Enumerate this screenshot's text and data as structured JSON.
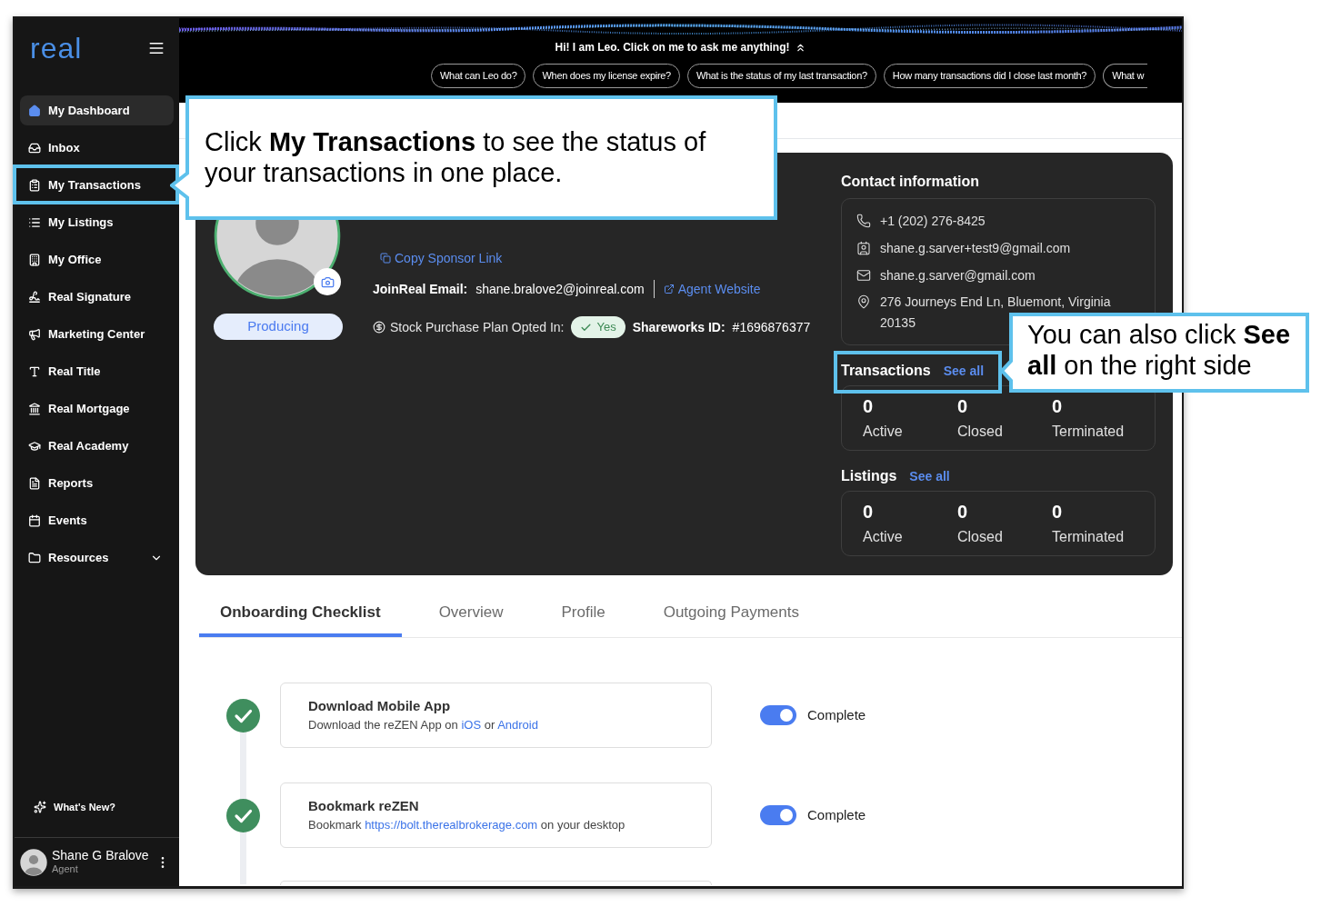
{
  "sidebar": {
    "logo": "real",
    "items": [
      {
        "label": "My Dashboard",
        "selected": true
      },
      {
        "label": "Inbox",
        "selected": false
      },
      {
        "label": "My Transactions",
        "selected": false
      },
      {
        "label": "My Listings",
        "selected": false
      },
      {
        "label": "My Office",
        "selected": false
      },
      {
        "label": "Real Signature",
        "selected": false
      },
      {
        "label": "Marketing Center",
        "selected": false
      },
      {
        "label": "Real Title",
        "selected": false
      },
      {
        "label": "Real Mortgage",
        "selected": false
      },
      {
        "label": "Real Academy",
        "selected": false
      },
      {
        "label": "Reports",
        "selected": false
      },
      {
        "label": "Events",
        "selected": false
      },
      {
        "label": "Resources",
        "selected": false,
        "expanded": false
      }
    ],
    "whats_new": "What's New?",
    "user": {
      "name": "Shane G Bralove",
      "role": "Agent"
    }
  },
  "assistant": {
    "greeting": "Hi! I am Leo. Click on me to ask me anything!",
    "suggestions": [
      "What can Leo do?",
      "When does my license expire?",
      "What is the status of my last transaction?",
      "How many transactions did I close last month?",
      "What w"
    ]
  },
  "profile": {
    "status": "Producing",
    "copy_link": "Copy Sponsor Link",
    "email_label": "JoinReal Email:",
    "email": "shane.bralove2@joinreal.com",
    "website_link": "Agent Website",
    "stock_label": "Stock Purchase Plan Opted In:",
    "stock_value": "Yes",
    "shareworks_label": "Shareworks ID:",
    "shareworks_id": "#1696876377"
  },
  "contact": {
    "title": "Contact information",
    "items": [
      {
        "kind": "phone",
        "text": "+1 (202) 276-8425"
      },
      {
        "kind": "id",
        "text": "shane.g.sarver+test9@gmail.com"
      },
      {
        "kind": "email",
        "text": "shane.g.sarver@gmail.com"
      },
      {
        "kind": "address",
        "text": "276 Journeys End Ln, Bluemont, Virginia 20135"
      }
    ]
  },
  "summaries": [
    {
      "title": "Transactions",
      "link": "See all",
      "counts": [
        {
          "value": "0",
          "label": "Active"
        },
        {
          "value": "0",
          "label": "Closed"
        },
        {
          "value": "0",
          "label": "Terminated"
        }
      ]
    },
    {
      "title": "Listings",
      "link": "See all",
      "counts": [
        {
          "value": "0",
          "label": "Active"
        },
        {
          "value": "0",
          "label": "Closed"
        },
        {
          "value": "0",
          "label": "Terminated"
        }
      ]
    }
  ],
  "tabs": [
    {
      "label": "Onboarding Checklist",
      "selected": true
    },
    {
      "label": "Overview",
      "selected": false
    },
    {
      "label": "Profile",
      "selected": false
    },
    {
      "label": "Outgoing Payments",
      "selected": false
    }
  ],
  "checklist": [
    {
      "done": true,
      "title": "Download Mobile App",
      "description": [
        {
          "kind": "text",
          "text": "Download the reZEN App on "
        },
        {
          "kind": "link",
          "text": "iOS"
        },
        {
          "kind": "text",
          "text": " or "
        },
        {
          "kind": "link",
          "text": "Android"
        }
      ],
      "toggle": {
        "on": true,
        "label": "Complete"
      }
    },
    {
      "done": true,
      "title": "Bookmark reZEN",
      "description": [
        {
          "kind": "text",
          "text": "Bookmark "
        },
        {
          "kind": "link",
          "text": "https://bolt.therealbrokerage.com"
        },
        {
          "kind": "text",
          "text": " on your desktop"
        }
      ],
      "toggle": {
        "on": true,
        "label": "Complete"
      }
    }
  ],
  "callouts": [
    {
      "text": "Click **My Transactions** to see the status of your transactions in one place."
    },
    {
      "text": "You can also click **See all** on the right side"
    }
  ]
}
